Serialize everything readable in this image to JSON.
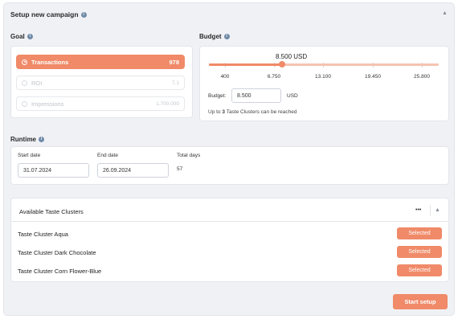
{
  "header": {
    "title": "Setup new campaign"
  },
  "goal": {
    "label": "Goal",
    "options": [
      {
        "label": "Transactions",
        "value": "978",
        "selected": true
      },
      {
        "label": "ROI",
        "value": "7.1",
        "selected": false
      },
      {
        "label": "Impressions",
        "value": "1.700.000",
        "selected": false
      }
    ]
  },
  "budget": {
    "label": "Budget",
    "slider_value_label": "8.500 USD",
    "slider_min": 400,
    "slider_max": 25800,
    "slider_value": 8500,
    "ticks": [
      "400",
      "6.750",
      "13.100",
      "19.450",
      "25.800"
    ],
    "input_label": "Budget:",
    "input_value": "8.500",
    "currency": "USD",
    "reach_prefix": "Up to",
    "reach_count": "3",
    "reach_suffix": "Taste Clusters can be reached"
  },
  "runtime": {
    "label": "Runtime",
    "start_label": "Start date",
    "start_value": "31.07.2024",
    "end_label": "End date",
    "end_value": "26.09.2024",
    "total_label": "Total days",
    "total_value": "57"
  },
  "clusters": {
    "title": "Available Taste Clusters",
    "more": "•••",
    "items": [
      {
        "name": "Taste Cluster Aqua",
        "button": "Selected"
      },
      {
        "name": "Taste Cluster Dark Chocolate",
        "button": "Selected"
      },
      {
        "name": "Taste Cluster Corn Flower-Blue",
        "button": "Selected"
      }
    ]
  },
  "footer": {
    "start_button": "Start setup"
  },
  "colors": {
    "accent": "#f08a68",
    "accent_light": "#f6c3b0",
    "panel": "#f0f1f5"
  }
}
